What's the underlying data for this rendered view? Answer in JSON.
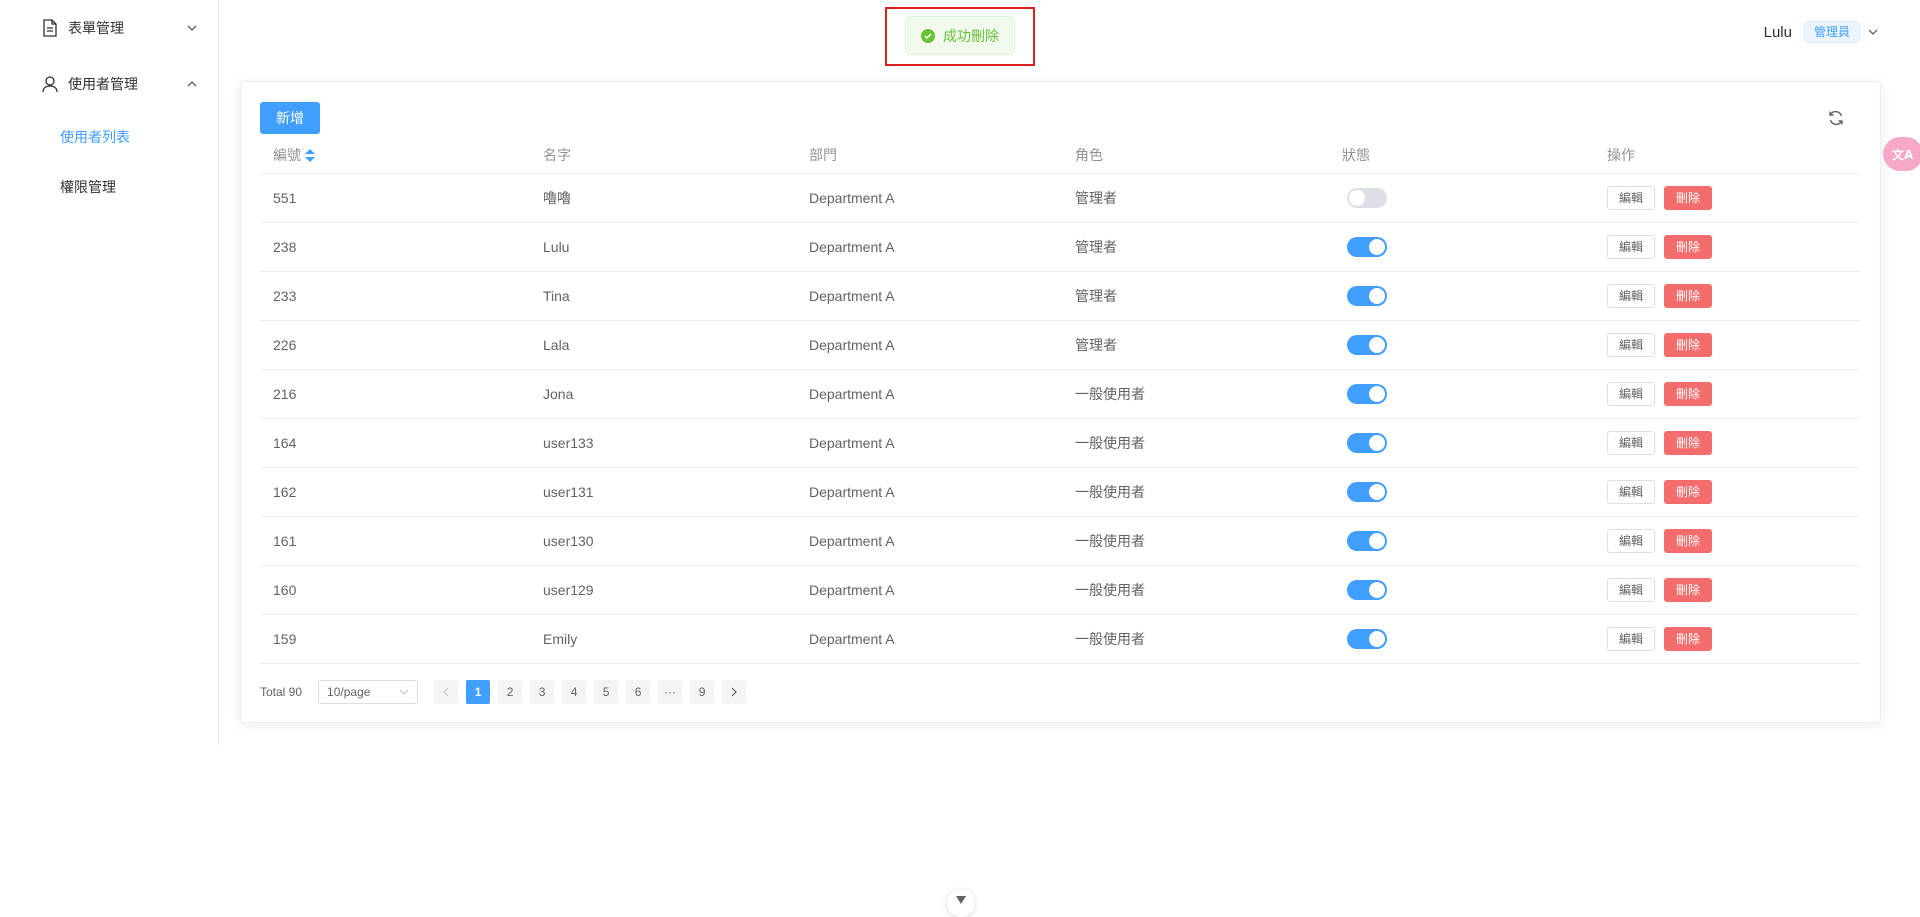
{
  "sidebar": {
    "menu_form": {
      "label": "表單管理",
      "icon": "document-icon",
      "expanded": false
    },
    "menu_users": {
      "label": "使用者管理",
      "icon": "user-icon",
      "expanded": true
    },
    "sub_items": [
      {
        "label": "使用者列表",
        "active": true
      },
      {
        "label": "權限管理",
        "active": false
      }
    ]
  },
  "header": {
    "user_name": "Lulu",
    "role_tag": "管理員"
  },
  "toast": {
    "message": "成功刪除",
    "type": "success"
  },
  "toolbar": {
    "add_label": "新增",
    "refresh_icon": "refresh-icon"
  },
  "table": {
    "columns": [
      "編號",
      "名字",
      "部門",
      "角色",
      "狀態",
      "操作"
    ],
    "edit_label": "編輯",
    "delete_label": "刪除",
    "rows": [
      {
        "id": "551",
        "name": "嚕嚕",
        "dept": "Department A",
        "role": "管理者",
        "status": false
      },
      {
        "id": "238",
        "name": "Lulu",
        "dept": "Department A",
        "role": "管理者",
        "status": true
      },
      {
        "id": "233",
        "name": "Tina",
        "dept": "Department A",
        "role": "管理者",
        "status": true
      },
      {
        "id": "226",
        "name": "Lala",
        "dept": "Department A",
        "role": "管理者",
        "status": true
      },
      {
        "id": "216",
        "name": "Jona",
        "dept": "Department A",
        "role": "一般使用者",
        "status": true
      },
      {
        "id": "164",
        "name": "user133",
        "dept": "Department A",
        "role": "一般使用者",
        "status": true
      },
      {
        "id": "162",
        "name": "user131",
        "dept": "Department A",
        "role": "一般使用者",
        "status": true
      },
      {
        "id": "161",
        "name": "user130",
        "dept": "Department A",
        "role": "一般使用者",
        "status": true
      },
      {
        "id": "160",
        "name": "user129",
        "dept": "Department A",
        "role": "一般使用者",
        "status": true
      },
      {
        "id": "159",
        "name": "Emily",
        "dept": "Department A",
        "role": "一般使用者",
        "status": true
      }
    ]
  },
  "pagination": {
    "total_label": "Total 90",
    "page_size": "10/page",
    "pages": [
      "1",
      "2",
      "3",
      "4",
      "5",
      "6",
      "···",
      "9"
    ],
    "current": "1"
  },
  "colors": {
    "primary": "#409eff",
    "danger": "#f56c6c",
    "success": "#67c23a",
    "highlight_outline": "#e02020"
  }
}
